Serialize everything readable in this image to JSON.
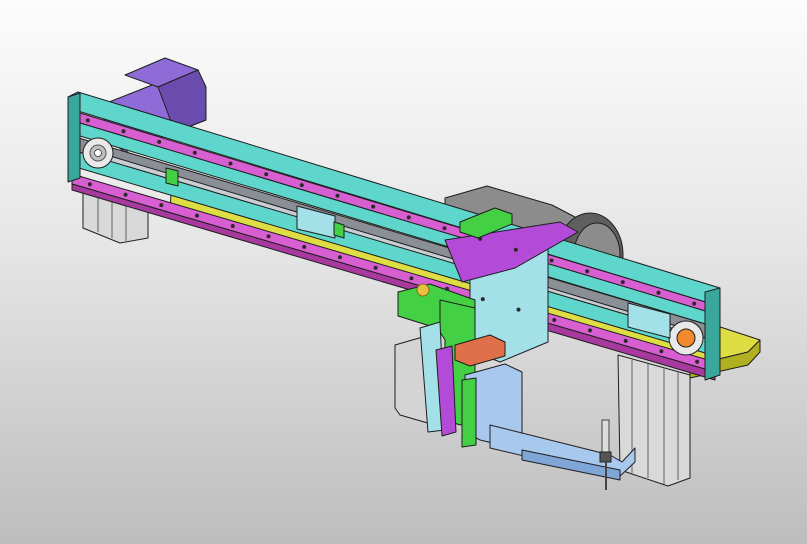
{
  "scene": {
    "background_top": "#fcfcfc",
    "background_bottom": "#bdbdbd",
    "palette": {
      "rail": "#5fd6cc",
      "rail_dark": "#3aa79d",
      "guide_strip": "#d85fd2",
      "guide_strip_dark": "#a8399f",
      "belt": "#8a8f95",
      "belt_slot": "#c9ced3",
      "motor": "#8e6bd6",
      "motor_dark": "#6a4cae",
      "gearbox": "#8c8c8c",
      "gearbox_dark": "#5f5f5f",
      "yellow_plate": "#dede44",
      "yellow_plate_dark": "#b0b020",
      "carriage": "#a3e0e8",
      "arm": "#a9c8ee",
      "arm_dark": "#7fa6d6",
      "green_block": "#44d044",
      "violet_bracket": "#b44ad8",
      "orange_block": "#e0704a",
      "cylinder": "#d4d4d4",
      "support_legs": "#d9d9d9",
      "pulley": "#e9e9e9",
      "pulley_orange": "#f08a2c"
    },
    "icons": [
      "pulley-icon",
      "screw-hole-icon",
      "vacuum-nozzle-icon"
    ]
  }
}
